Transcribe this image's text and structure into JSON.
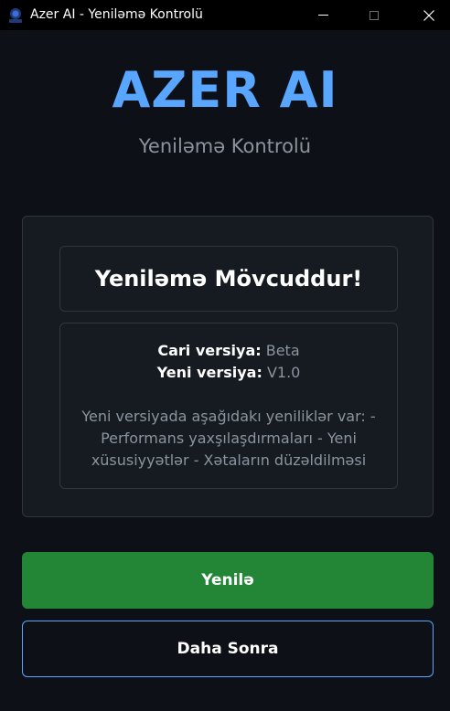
{
  "window": {
    "title": "Azer AI - Yeniləmə Kontrolü",
    "icon": "azer-ai-app-icon",
    "controls": [
      "minimize-icon",
      "maximize-icon",
      "close-icon"
    ]
  },
  "header": {
    "brand": "AZER AI",
    "subtitle": "Yeniləmə Kontrolü"
  },
  "update_panel": {
    "heading": "Yeniləmə Mövcuddur!",
    "current_version_label": "Cari versiya:",
    "current_version_value": "Beta",
    "new_version_label": "Yeni versiya:",
    "new_version_value": "V1.0",
    "notes": "Yeni versiyada aşağıdakı yeniliklər var: - Performans yaxşılaşdırmaları - Yeni xüsusiyyətlər - Xətaların düzəldilməsi"
  },
  "actions": {
    "update_label": "Yenilə",
    "later_label": "Daha Sonra"
  },
  "colors": {
    "background": "#0d1117",
    "panel": "#161b22",
    "border": "#30363d",
    "brand": "#58a6ff",
    "muted_text": "#8b949e",
    "update_button": "#238636",
    "later_button_border": "#58a6ff"
  }
}
